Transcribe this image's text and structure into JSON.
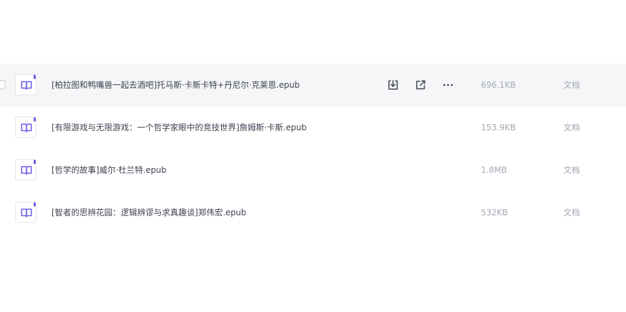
{
  "colors": {
    "accent": "#6b5ce7",
    "hover_row": "#f5f6f8",
    "text_primary": "#3d4150",
    "text_secondary": "#a2a7b3"
  },
  "files": [
    {
      "name": "[柏拉图和鸭嘴兽一起去酒吧]托马斯·卡斯卡特+丹尼尔·克莱恩.epub",
      "size": "696.1KB",
      "type": "文档",
      "icon": "book-icon",
      "hovered": true
    },
    {
      "name": "[有限游戏与无限游戏：一个哲学家眼中的竞技世界]詹姆斯·卡斯.epub",
      "size": "153.9KB",
      "type": "文档",
      "icon": "book-icon"
    },
    {
      "name": "[哲学的故事]威尔·杜兰特.epub",
      "size": "1.8MB",
      "type": "文档",
      "icon": "book-icon"
    },
    {
      "name": "[智者的思辨花园：逻辑辨谬与求真趣谈]郑伟宏.epub",
      "size": "532KB",
      "type": "文档",
      "icon": "book-icon"
    }
  ],
  "row_actions": [
    "download-icon",
    "share-icon",
    "more-icon"
  ]
}
